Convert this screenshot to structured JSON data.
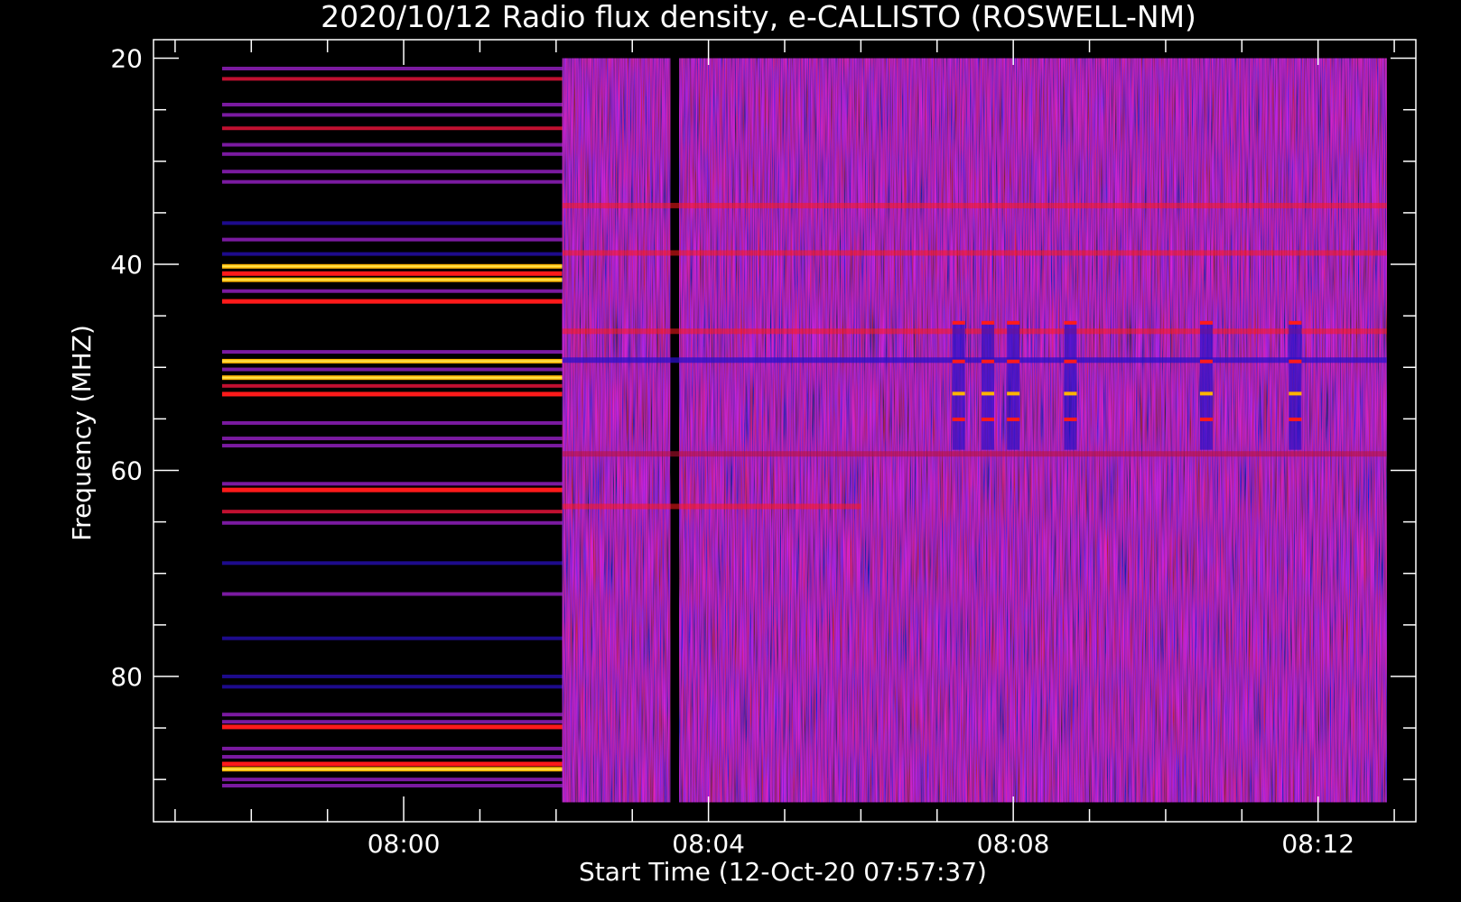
{
  "chart_data": {
    "type": "heatmap",
    "title": "2020/10/12  Radio flux density, e-CALLISTO (ROSWELL-NM)",
    "xlabel": "Start Time (12-Oct-20 07:57:37)",
    "ylabel": "Frequency (MHZ)",
    "x_axis": {
      "unit": "time",
      "range": [
        "07:56:43",
        "08:13:17"
      ],
      "major_ticks": [
        "08:00",
        "08:04",
        "08:08",
        "08:12"
      ],
      "minor_tick_interval_minutes": 1
    },
    "y_axis": {
      "unit": "MHz",
      "range": [
        18.2,
        94.1
      ],
      "inverted": true,
      "major_ticks": [
        20,
        40,
        60,
        80
      ],
      "minor_tick_interval": 5
    },
    "data_extent": {
      "time_range": [
        "07:57:37",
        "08:12:54"
      ],
      "frequency_range": [
        20,
        92.2
      ]
    },
    "segments": [
      {
        "start": "07:57:37",
        "end": "08:02:05",
        "kind": "sparse channels"
      },
      {
        "start": "08:02:05",
        "end": "08:03:30",
        "kind": "full spectrum"
      },
      {
        "start": "08:03:30",
        "end": "08:03:37",
        "kind": "data gap"
      },
      {
        "start": "08:03:37",
        "end": "08:12:54",
        "kind": "full spectrum"
      }
    ],
    "sparse_channels": [
      {
        "f": 21.0,
        "level": "medium"
      },
      {
        "f": 22.0,
        "level": "medium-high"
      },
      {
        "f": 24.5,
        "level": "medium"
      },
      {
        "f": 25.5,
        "level": "medium"
      },
      {
        "f": 26.8,
        "level": "medium-high"
      },
      {
        "f": 28.4,
        "level": "medium"
      },
      {
        "f": 29.3,
        "level": "medium"
      },
      {
        "f": 31.0,
        "level": "medium"
      },
      {
        "f": 32.0,
        "level": "medium"
      },
      {
        "f": 36.0,
        "level": "low"
      },
      {
        "f": 37.6,
        "level": "medium"
      },
      {
        "f": 39.0,
        "level": "low"
      },
      {
        "f": 40.2,
        "level": "very-high"
      },
      {
        "f": 40.9,
        "level": "high"
      },
      {
        "f": 41.5,
        "level": "very-high"
      },
      {
        "f": 42.6,
        "level": "medium"
      },
      {
        "f": 43.6,
        "level": "high"
      },
      {
        "f": 48.5,
        "level": "medium"
      },
      {
        "f": 49.4,
        "level": "very-high"
      },
      {
        "f": 50.2,
        "level": "medium"
      },
      {
        "f": 51.0,
        "level": "very-high"
      },
      {
        "f": 51.8,
        "level": "medium-high"
      },
      {
        "f": 52.6,
        "level": "high"
      },
      {
        "f": 55.4,
        "level": "medium"
      },
      {
        "f": 56.9,
        "level": "medium"
      },
      {
        "f": 57.6,
        "level": "medium"
      },
      {
        "f": 61.3,
        "level": "medium"
      },
      {
        "f": 61.9,
        "level": "high"
      },
      {
        "f": 64.0,
        "level": "medium-high"
      },
      {
        "f": 65.1,
        "level": "medium"
      },
      {
        "f": 69.0,
        "level": "low"
      },
      {
        "f": 72.0,
        "level": "medium"
      },
      {
        "f": 76.3,
        "level": "low"
      },
      {
        "f": 80.0,
        "level": "low"
      },
      {
        "f": 81.0,
        "level": "low"
      },
      {
        "f": 83.7,
        "level": "medium"
      },
      {
        "f": 84.4,
        "level": "medium"
      },
      {
        "f": 84.9,
        "level": "high"
      },
      {
        "f": 87.0,
        "level": "medium"
      },
      {
        "f": 87.8,
        "level": "medium"
      },
      {
        "f": 88.5,
        "level": "high"
      },
      {
        "f": 89.0,
        "level": "very-high"
      },
      {
        "f": 90.0,
        "level": "medium"
      },
      {
        "f": 90.6,
        "level": "medium"
      }
    ],
    "features": [
      {
        "kind": "band",
        "f": 34.3,
        "level": "high"
      },
      {
        "kind": "band",
        "f": 38.9,
        "level": "high"
      },
      {
        "kind": "band",
        "f": 46.5,
        "level": "high"
      },
      {
        "kind": "band",
        "f": 49.3,
        "level": "low"
      },
      {
        "kind": "band",
        "f": 58.4,
        "level": "medium-high"
      },
      {
        "kind": "band",
        "f": 63.5,
        "level": "high",
        "time_range": [
          "08:02:05",
          "08:06:00"
        ]
      },
      {
        "kind": "burst",
        "time": "08:07:17",
        "f_range": [
          45.5,
          58
        ]
      },
      {
        "kind": "burst",
        "time": "08:07:40",
        "f_range": [
          45.5,
          58
        ]
      },
      {
        "kind": "burst",
        "time": "08:08:00",
        "f_range": [
          45.5,
          58
        ]
      },
      {
        "kind": "burst",
        "time": "08:08:45",
        "f_range": [
          45.5,
          58
        ]
      },
      {
        "kind": "burst",
        "time": "08:10:32",
        "f_range": [
          45.5,
          58
        ]
      },
      {
        "kind": "burst",
        "time": "08:11:42",
        "f_range": [
          45.5,
          58
        ]
      }
    ],
    "colors": {
      "background": "#000000",
      "low": "#2a10c8",
      "medium": "#7a1aa0",
      "medium-high": "#c01030",
      "high": "#ff1a1a",
      "very-high": "#ffb400",
      "axes": "#ffffff"
    },
    "grid": false,
    "legend": "none"
  }
}
